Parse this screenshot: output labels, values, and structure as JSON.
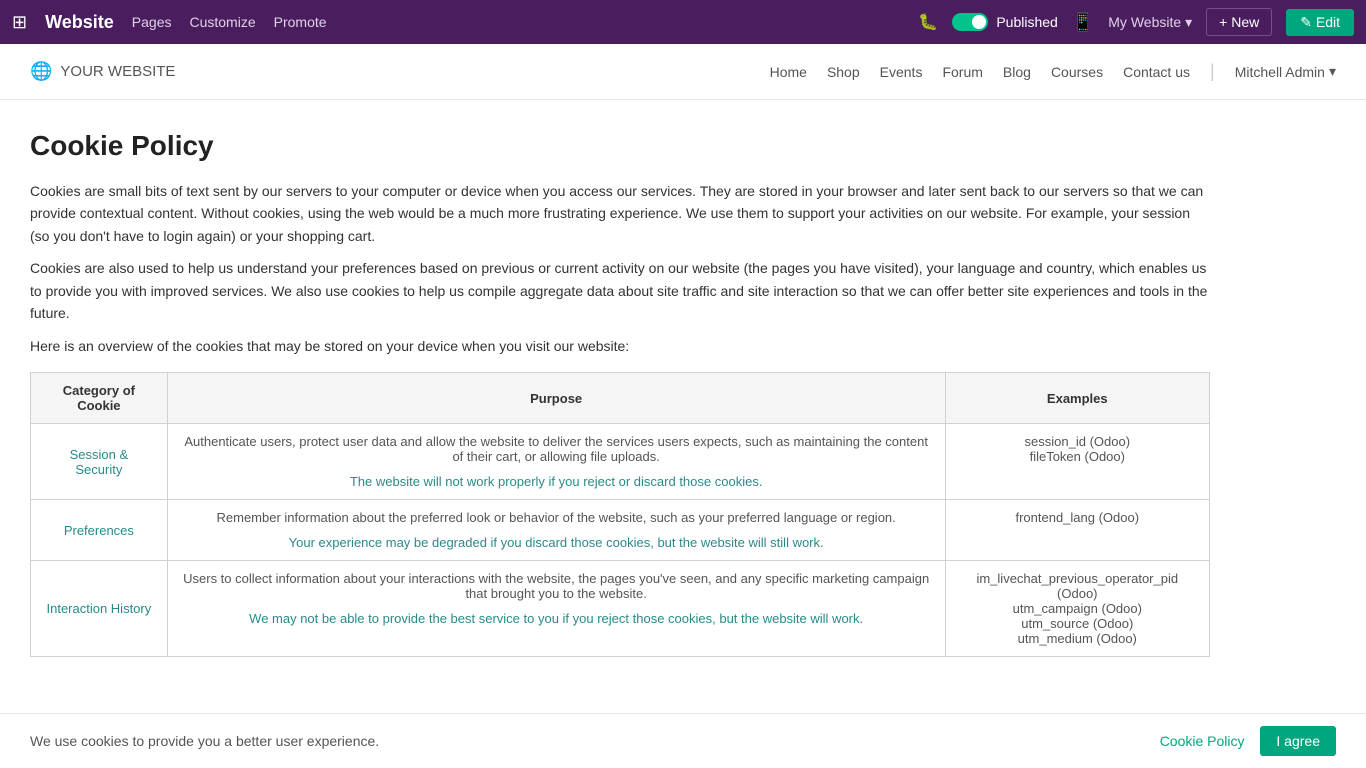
{
  "topbar": {
    "apps_icon": "⊞",
    "brand": "Website",
    "nav": [
      "Pages",
      "Customize",
      "Promote"
    ],
    "bug_icon": "🐛",
    "published_label": "Published",
    "mobile_icon": "📱",
    "my_website": "My Website",
    "new_label": "+ New",
    "edit_label": "✎ Edit"
  },
  "sitenav": {
    "logo_icon": "🌐",
    "logo_text": "YOUR WEBSITE",
    "menu": [
      "Home",
      "Shop",
      "Events",
      "Forum",
      "Blog",
      "Courses",
      "Contact us"
    ],
    "admin": "Mitchell Admin"
  },
  "page": {
    "title": "Cookie Policy",
    "intro1": "Cookies are small bits of text sent by our servers to your computer or device when you access our services. They are stored in your browser and later sent back to our servers so that we can provide contextual content. Without cookies, using the web would be a much more frustrating experience. We use them to support your activities on our website. For example, your session (so you don't have to login again) or your shopping cart.",
    "intro2": "Cookies are also used to help us understand your preferences based on previous or current activity on our website (the pages you have visited), your language and country, which enables us to provide you with improved services. We also use cookies to help us compile aggregate data about site traffic and site interaction so that we can offer better site experiences and tools in the future.",
    "overview": "Here is an overview of the cookies that may be stored on your device when you visit our website:"
  },
  "table": {
    "headers": [
      "Category of Cookie",
      "Purpose",
      "Examples"
    ],
    "rows": [
      {
        "category": "Session & Security",
        "purpose_main": "Authenticate users, protect user data and allow the website to deliver the services users expects, such as maintaining the content of their cart, or allowing file uploads.",
        "purpose_note": "The website will not work properly if you reject or discard those cookies.",
        "examples": [
          "session_id (Odoo)",
          "fileToken (Odoo)"
        ]
      },
      {
        "category": "Preferences",
        "purpose_main": "Remember information about the preferred look or behavior of the website, such as your preferred language or region.",
        "purpose_note": "Your experience may be degraded if you discard those cookies, but the website will still work.",
        "examples": [
          "frontend_lang (Odoo)"
        ]
      },
      {
        "category": "Interaction History",
        "purpose_main": "Users to collect information about your interactions with the website, the pages you've seen, and any specific marketing campaign that brought you to the website.",
        "purpose_note": "We may not be able to provide the best service to you if you reject those cookies, but the website will work.",
        "examples": [
          "im_livechat_previous_operator_pid (Odoo)",
          "utm_campaign (Odoo)",
          "utm_source (Odoo)",
          "utm_medium (Odoo)"
        ]
      }
    ]
  },
  "banner": {
    "text": "We use cookies to provide you a better user experience.",
    "policy_link": "Cookie Policy",
    "agree_button": "I agree"
  }
}
